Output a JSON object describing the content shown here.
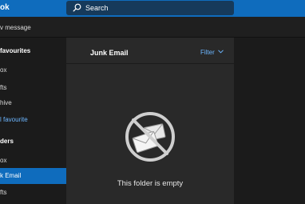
{
  "app": {
    "title": "ok"
  },
  "search": {
    "label": "Search",
    "icon": "search-icon"
  },
  "toolbar": {
    "new_message_label": "v message"
  },
  "sidebar": {
    "items": [
      {
        "label": "favourites",
        "type": "header"
      },
      {
        "label": "ox",
        "type": "item"
      },
      {
        "label": "fts",
        "type": "item"
      },
      {
        "label": "hive",
        "type": "item"
      },
      {
        "label": "l favourite",
        "type": "link"
      },
      {
        "label": "ders",
        "type": "header"
      },
      {
        "label": "ox",
        "type": "item"
      },
      {
        "label": "k Email",
        "type": "active"
      },
      {
        "label": "fts",
        "type": "item"
      }
    ]
  },
  "list_pane": {
    "title": "Junk Email",
    "filter_label": "Filter",
    "empty_message": "This folder is empty",
    "empty_icon": "no-mail-icon"
  },
  "colors": {
    "accent": "#0f6cbd",
    "link": "#6cb6ff",
    "background": "#1f1f1f",
    "pane": "#292929"
  }
}
